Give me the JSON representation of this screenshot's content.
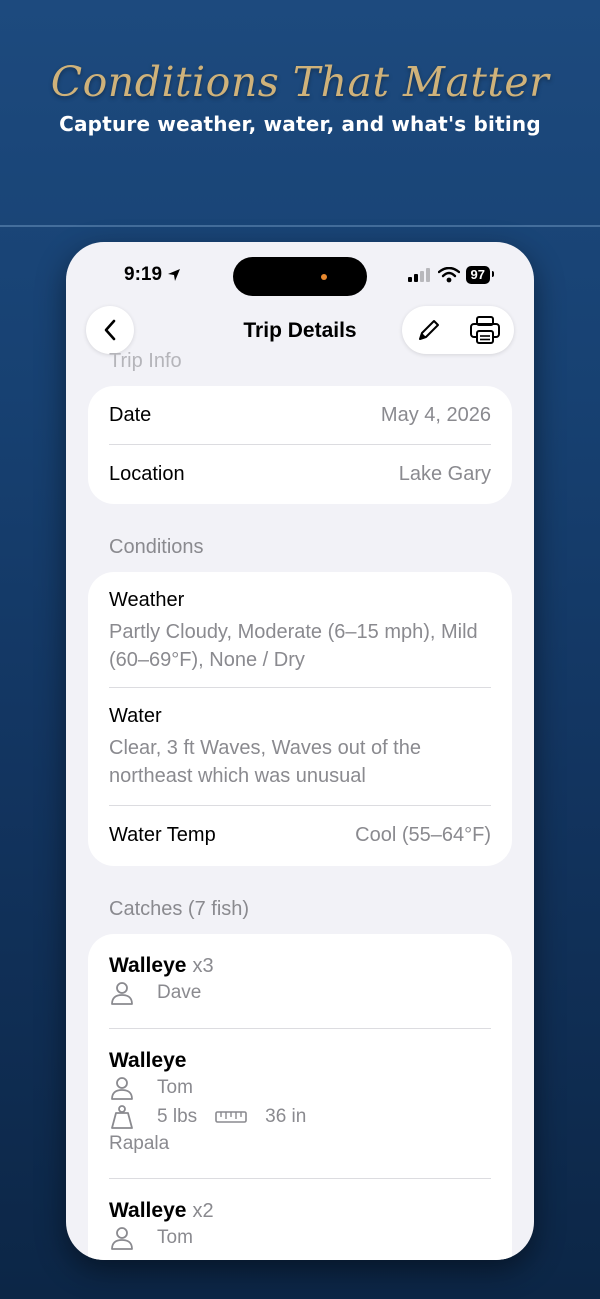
{
  "promo": {
    "headline": "Conditions That Matter",
    "subhead": "Capture weather, water, and what's biting"
  },
  "status_bar": {
    "time": "9:19",
    "battery": "97"
  },
  "nav": {
    "title": "Trip Details"
  },
  "trip_info": {
    "header": "Trip Info",
    "rows": [
      {
        "label": "Date",
        "value": "May 4, 2026"
      },
      {
        "label": "Location",
        "value": "Lake Gary"
      }
    ]
  },
  "conditions": {
    "header": "Conditions",
    "weather_label": "Weather",
    "weather_value": "Partly Cloudy, Moderate (6–15 mph), Mild (60–69°F), None / Dry",
    "water_label": "Water",
    "water_value": "Clear, 3 ft Waves, Waves out of the northeast which was unusual",
    "water_temp_label": "Water Temp",
    "water_temp_value": "Cool (55–64°F)"
  },
  "catches": {
    "header": "Catches (7 fish)",
    "items": [
      {
        "species": "Walleye",
        "count": "x3",
        "angler": "Dave"
      },
      {
        "species": "Walleye",
        "angler": "Tom",
        "weight": "5 lbs",
        "length": "36 in",
        "lure": "Rapala"
      },
      {
        "species": "Walleye",
        "count": "x2",
        "angler": "Tom"
      }
    ]
  },
  "icons": {
    "back": "chevron-left-icon",
    "edit": "pencil-icon",
    "print": "printer-icon",
    "angler": "person-icon",
    "weight": "weight-icon",
    "length": "ruler-icon",
    "location": "location-arrow-icon"
  },
  "colors": {
    "background_top": "#1d4a7e",
    "background_bottom": "#0c2646",
    "headline": "#cfb27a",
    "secondary_text": "#8a8a8f",
    "card": "#ffffff",
    "screen": "#f2f2f7"
  }
}
